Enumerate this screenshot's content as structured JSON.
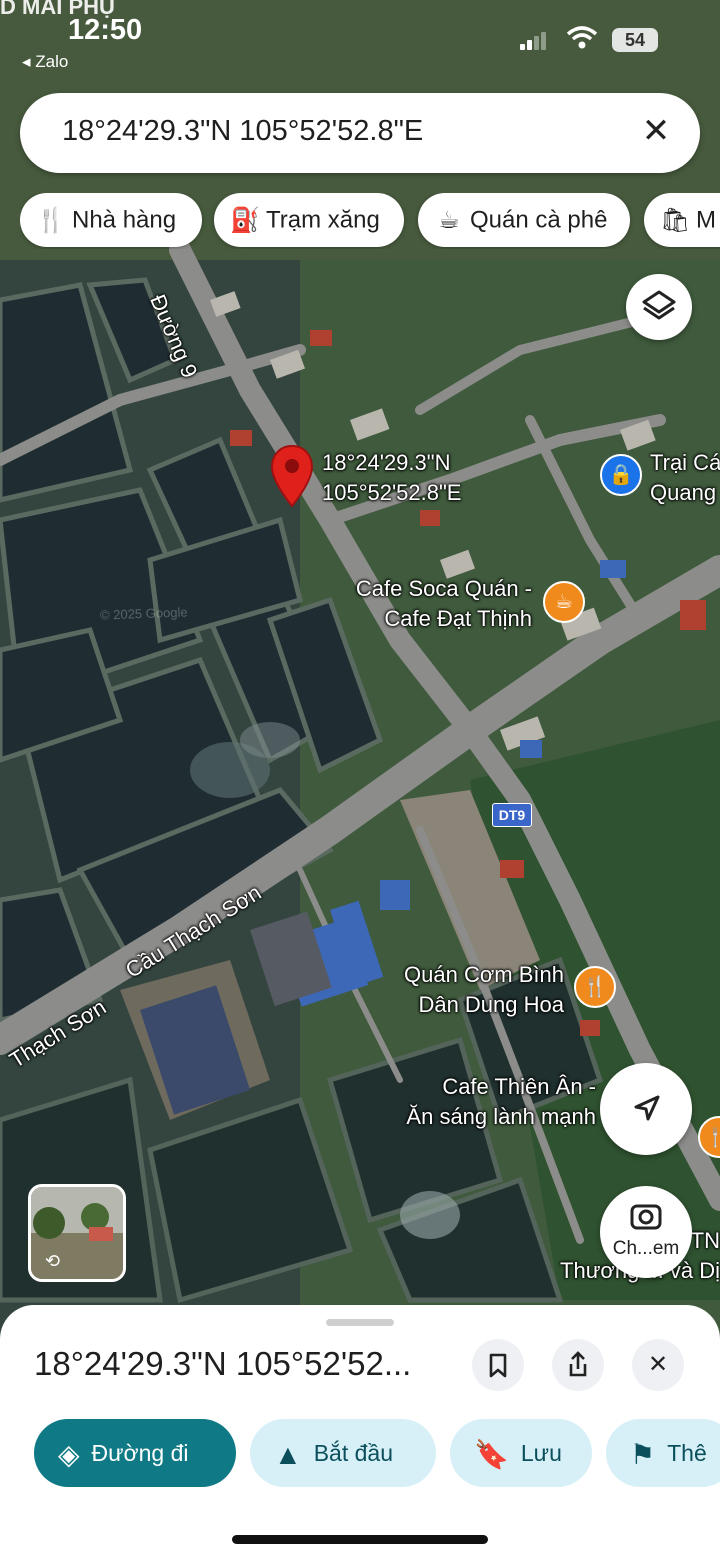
{
  "status_bar": {
    "carrier_text": "D MAI PHỤ",
    "time": "12:50",
    "back_app": "◂ Zalo",
    "battery": "54"
  },
  "search": {
    "query": "18°24'29.3\"N 105°52'52.8\"E",
    "close_icon": "close-icon"
  },
  "chips": [
    {
      "label": "Nhà hàng",
      "icon": "restaurant-icon"
    },
    {
      "label": "Trạm xăng",
      "icon": "gas-station-icon"
    },
    {
      "label": "Quán cà phê",
      "icon": "coffee-icon"
    },
    {
      "label": "M",
      "icon": "shopping-bag-icon"
    }
  ],
  "map": {
    "pin_label_line1": "18°24'29.3\"N",
    "pin_label_line2": "105°52'52.8\"E",
    "road_duong9": "Đường 9",
    "road_cau_thach_son": "Cầu Thạch Sơn",
    "road_thach_son": "Thạch Sơn",
    "road_badge_dt9": "DT9",
    "poi_trai_line1": "Trại Cá",
    "poi_trai_line2": "Quang",
    "poi_cafe_soca_line1": "Cafe Soca Quán -",
    "poi_cafe_soca_line2": "Cafe Đạt Thịnh",
    "poi_quan_com_line1": "Quán Cơm Bình",
    "poi_quan_com_line2": "Dân Dung Hoa",
    "poi_cafe_thien_an_line1": "Cafe Thiên Ân -",
    "poi_cafe_thien_an_line2": "Ăn sáng lành mạnh",
    "poi_thuong_line1": "y TN",
    "poi_thuong_line2": "Thương ... và Dị",
    "lens_label": "Ch...em",
    "watermark": "© 2025 Google"
  },
  "sheet": {
    "title": "18°24'29.3\"N 105°52'52...",
    "actions": [
      {
        "label": "Đường đi",
        "icon": "directions-icon"
      },
      {
        "label": "Bắt đầu",
        "icon": "navigation-arrow-icon"
      },
      {
        "label": "Lưu",
        "icon": "bookmark-icon"
      },
      {
        "label": "Thê",
        "icon": "flag-icon"
      }
    ]
  },
  "colors": {
    "accent": "#0f7a86",
    "action_bg": "#d7f0f8",
    "pin_red": "#e0201b",
    "poi_orange": "#f08a1c",
    "poi_blue": "#1a73e8"
  }
}
